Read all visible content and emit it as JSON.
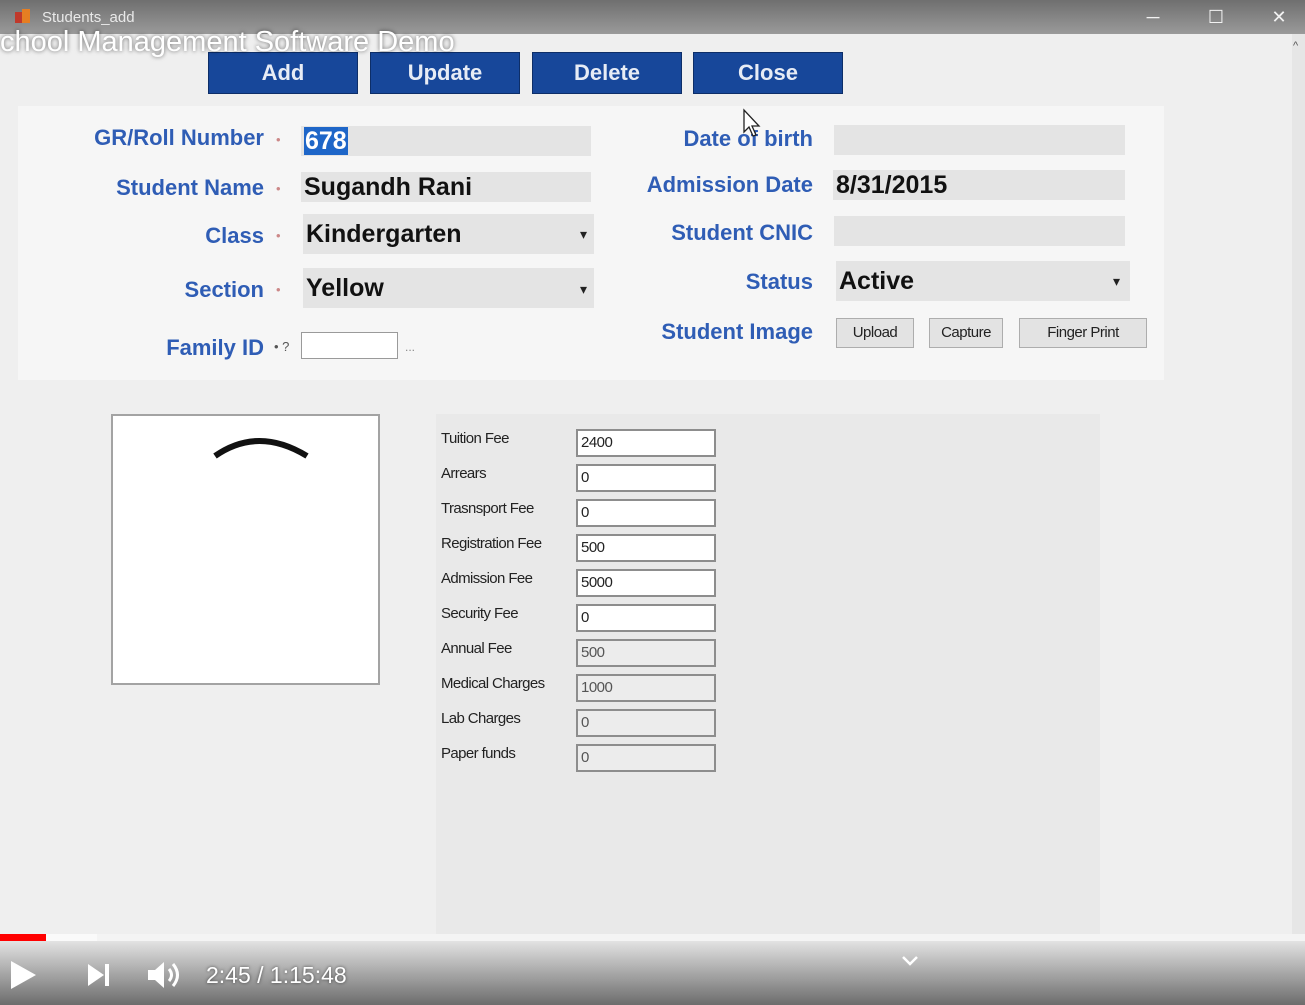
{
  "window": {
    "title": "Students_add",
    "minimize": "─",
    "maximize": "☐",
    "close": "✕"
  },
  "video_title": "chool Management Software Demo",
  "toolbar": {
    "add": "Add",
    "update": "Update",
    "delete": "Delete",
    "close": "Close"
  },
  "form": {
    "gr_label": "GR/Roll Number",
    "gr_value": "678",
    "name_label": "Student Name",
    "name_value": "Sugandh Rani",
    "class_label": "Class",
    "class_value": "Kindergarten",
    "section_label": "Section",
    "section_value": "Yellow",
    "family_label": "Family ID",
    "family_req": "• ?",
    "family_browse": "...",
    "dob_label": "Date of birth",
    "dob_value": "",
    "admission_label": "Admission Date",
    "admission_value": "8/31/2015",
    "cnic_label": "Student CNIC",
    "cnic_value": "",
    "status_label": "Status",
    "status_value": "Active",
    "image_label": "Student Image",
    "required_mark": "•",
    "dropdown_arrow": "▾"
  },
  "image_buttons": {
    "upload": "Upload",
    "capture": "Capture",
    "finger": "Finger Print"
  },
  "fees": [
    {
      "label": "Tuition Fee",
      "value": "2400"
    },
    {
      "label": "Arrears",
      "value": "0"
    },
    {
      "label": "Trasnsport Fee",
      "value": "0"
    },
    {
      "label": "Registration Fee",
      "value": "500"
    },
    {
      "label": "Admission Fee",
      "value": "5000"
    },
    {
      "label": "Security Fee",
      "value": "0"
    },
    {
      "label": "Annual Fee",
      "value": "500"
    },
    {
      "label": "Medical Charges",
      "value": "1000"
    },
    {
      "label": "Lab Charges",
      "value": "0"
    },
    {
      "label": "Paper funds",
      "value": "0"
    }
  ],
  "player": {
    "time": "2:45 / 1:15:48",
    "progress": 0.035,
    "buffered": 0.074
  },
  "colors": {
    "button_blue": "#17479a",
    "label_blue": "#2f5db5",
    "progress_red": "#ff0000"
  }
}
